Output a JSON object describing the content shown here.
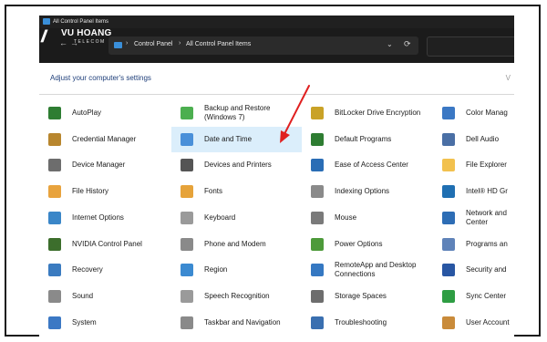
{
  "window": {
    "title": "All Control Panel Items"
  },
  "addressbar": {
    "crumbs": [
      "Control Panel",
      "All Control Panel Items"
    ],
    "separator": "›",
    "dropdown_glyph": "⌄",
    "refresh_glyph": "⟳",
    "back_glyph": "←",
    "forward_glyph": "→"
  },
  "watermark": {
    "name": "VU HOANG",
    "sub": "TELECOM"
  },
  "content": {
    "heading": "Adjust your computer's settings",
    "view_by": "V"
  },
  "items": [
    {
      "label": "AutoPlay",
      "icon": "autoplay-icon",
      "color": "#2e7d32"
    },
    {
      "label": "Backup and Restore\n(Windows 7)",
      "icon": "backup-icon",
      "color": "#4caf50"
    },
    {
      "label": "BitLocker Drive Encryption",
      "icon": "key-icon",
      "color": "#c9a227"
    },
    {
      "label": "Color Manag",
      "icon": "color-management-icon",
      "color": "#3b78c4"
    },
    {
      "label": "Credential Manager",
      "icon": "credential-icon",
      "color": "#b8862e"
    },
    {
      "label": "Date and Time",
      "icon": "clock-icon",
      "color": "#4a90d9"
    },
    {
      "label": "Default Programs",
      "icon": "default-programs-icon",
      "color": "#2e7d32"
    },
    {
      "label": "Dell Audio",
      "icon": "audio-icon",
      "color": "#4a6fa5"
    },
    {
      "label": "Device Manager",
      "icon": "device-manager-icon",
      "color": "#6d6d6d"
    },
    {
      "label": "Devices and Printers",
      "icon": "printer-icon",
      "color": "#555555"
    },
    {
      "label": "Ease of Access Center",
      "icon": "ease-of-access-icon",
      "color": "#2a6db5"
    },
    {
      "label": "File Explorer",
      "icon": "folder-icon",
      "color": "#f2c14e"
    },
    {
      "label": "File History",
      "icon": "file-history-icon",
      "color": "#e8a33d"
    },
    {
      "label": "Fonts",
      "icon": "fonts-icon",
      "color": "#e6a33a"
    },
    {
      "label": "Indexing Options",
      "icon": "search-icon",
      "color": "#8a8a8a"
    },
    {
      "label": "Intel® HD Gr",
      "icon": "intel-graphics-icon",
      "color": "#1f6fb2"
    },
    {
      "label": "Internet Options",
      "icon": "globe-icon",
      "color": "#3a86c8"
    },
    {
      "label": "Keyboard",
      "icon": "keyboard-icon",
      "color": "#9a9a9a"
    },
    {
      "label": "Mouse",
      "icon": "mouse-icon",
      "color": "#7a7a7a"
    },
    {
      "label": "Network and\nCenter",
      "icon": "network-icon",
      "color": "#2d6db5"
    },
    {
      "label": "NVIDIA Control Panel",
      "icon": "nvidia-icon",
      "color": "#3c6e2c"
    },
    {
      "label": "Phone and Modem",
      "icon": "phone-icon",
      "color": "#8a8a8a"
    },
    {
      "label": "Power Options",
      "icon": "power-icon",
      "color": "#4d9a3a"
    },
    {
      "label": "Programs an",
      "icon": "programs-icon",
      "color": "#5f83b9"
    },
    {
      "label": "Recovery",
      "icon": "recovery-icon",
      "color": "#3a7bc0"
    },
    {
      "label": "Region",
      "icon": "region-icon",
      "color": "#3b8ad1"
    },
    {
      "label": "RemoteApp and Desktop\nConnections",
      "icon": "remoteapp-icon",
      "color": "#3578c2"
    },
    {
      "label": "Security and",
      "icon": "flag-icon",
      "color": "#2856a3"
    },
    {
      "label": "Sound",
      "icon": "speaker-icon",
      "color": "#8a8a8a"
    },
    {
      "label": "Speech Recognition",
      "icon": "microphone-icon",
      "color": "#9a9a9a"
    },
    {
      "label": "Storage Spaces",
      "icon": "storage-icon",
      "color": "#6d6d6d"
    },
    {
      "label": "Sync Center",
      "icon": "sync-icon",
      "color": "#2e9d43"
    },
    {
      "label": "System",
      "icon": "system-icon",
      "color": "#3b78c4"
    },
    {
      "label": "Taskbar and Navigation",
      "icon": "taskbar-icon",
      "color": "#8a8a8a"
    },
    {
      "label": "Troubleshooting",
      "icon": "troubleshooting-icon",
      "color": "#3a6fb0"
    },
    {
      "label": "User Account",
      "icon": "user-accounts-icon",
      "color": "#c98b3a"
    }
  ],
  "selected_item": "Date and Time",
  "annotation": {
    "arrow_color": "#e02020"
  }
}
